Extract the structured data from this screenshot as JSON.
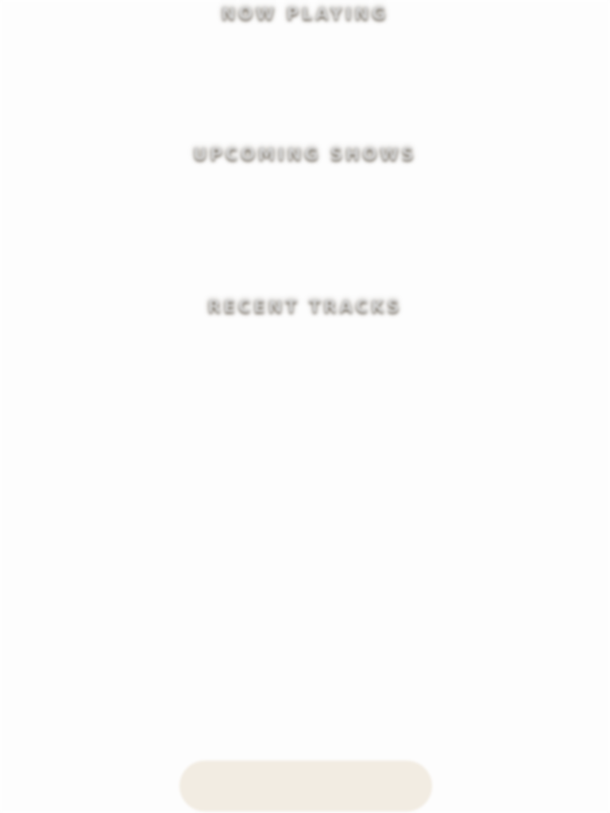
{
  "sections": {
    "now_playing": {
      "heading": "NOW PLAYING"
    },
    "upcoming_shows": {
      "heading": "UPCOMING SHOWS"
    },
    "recent_tracks": {
      "heading": "RECENT TRACKS"
    }
  },
  "colors": {
    "background": "#fdfdfd",
    "heading_text": "#d2d2d2",
    "heading_shadow": "#463c2d",
    "bottom_pill": "#f2ece2"
  }
}
